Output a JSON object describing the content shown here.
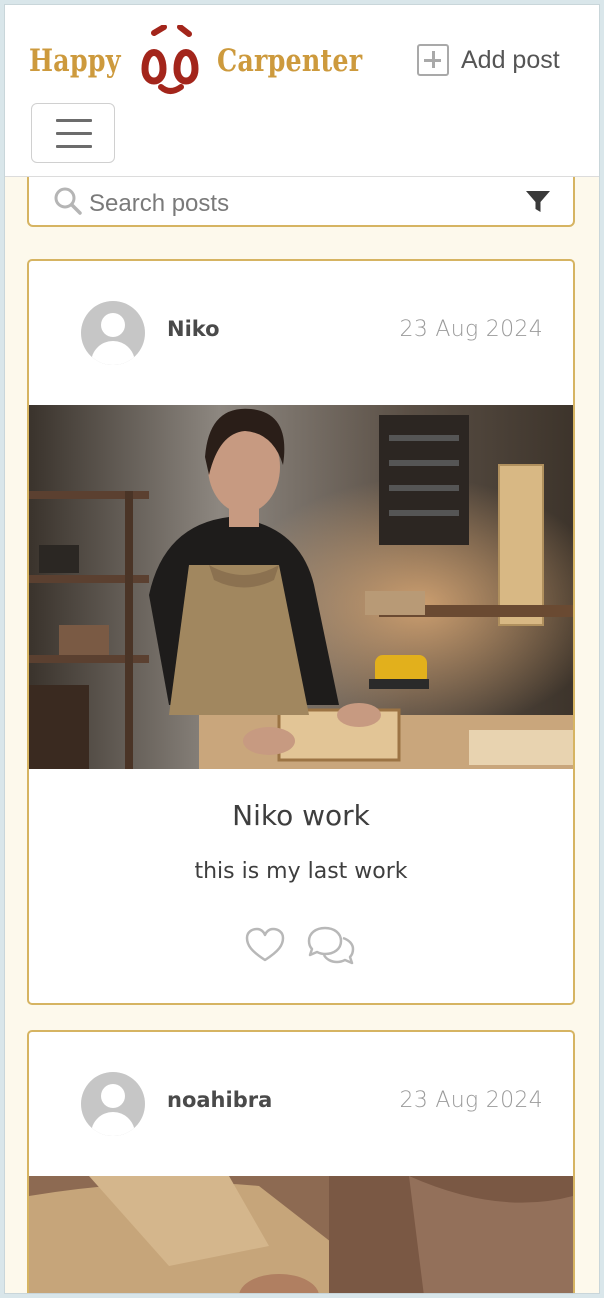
{
  "brand": {
    "word_left": "Happy",
    "word_right": "Carpenter",
    "logo_icon": "smiley-face-logo",
    "color_gold": "#cd9a3d",
    "color_red": "#a3251b"
  },
  "nav": {
    "add_post_label": "Add post",
    "add_post_icon": "plus-square-icon",
    "menu_icon": "hamburger-icon"
  },
  "search": {
    "placeholder": "Search posts",
    "value": "",
    "icon": "search-icon",
    "filter_icon": "filter-icon"
  },
  "posts": [
    {
      "author": "Niko",
      "date": "23 Aug 2024",
      "title": "Niko work",
      "body": "this is my last work",
      "image": "woman-carpenter-in-workshop-photo",
      "like_icon": "heart-icon",
      "comment_icon": "comments-icon"
    },
    {
      "author": "noahibra",
      "date": "23 Aug 2024",
      "image": "woodworking-hands-photo"
    }
  ],
  "colors": {
    "accent_border": "#d6b462",
    "page_background": "#fdf9ec"
  }
}
